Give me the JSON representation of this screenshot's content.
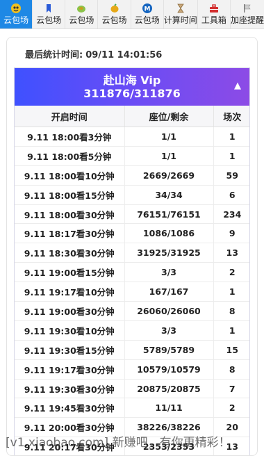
{
  "tabs": [
    {
      "label": "云包场",
      "icon": "eye-icon",
      "active": true
    },
    {
      "label": "云包场",
      "icon": "bookmark-icon",
      "active": false
    },
    {
      "label": "云包场",
      "icon": "coin-icon",
      "active": false
    },
    {
      "label": "云包场",
      "icon": "lemon-icon",
      "active": false
    },
    {
      "label": "云包场",
      "icon": "m-badge-icon",
      "active": false
    },
    {
      "label": "计算时间",
      "icon": "hourglass-icon",
      "active": false
    },
    {
      "label": "工具箱",
      "icon": "toolbox-icon",
      "active": false
    },
    {
      "label": "加座提醒",
      "icon": "flag-icon",
      "active": false
    }
  ],
  "stats": {
    "label": "最后统计时间:",
    "value": "09/11 14:01:56"
  },
  "panel": {
    "title": "赴山海 Vip",
    "count": "311876/311876",
    "collapse_glyph": "▲"
  },
  "table": {
    "headers": [
      "开启时间",
      "座位/剩余",
      "场次"
    ],
    "rows": [
      [
        "9.11 18:00看3分钟",
        "1/1",
        "1"
      ],
      [
        "9.11 18:00看5分钟",
        "1/1",
        "1"
      ],
      [
        "9.11 18:00看10分钟",
        "2669/2669",
        "59"
      ],
      [
        "9.11 18:00看15分钟",
        "34/34",
        "6"
      ],
      [
        "9.11 18:00看30分钟",
        "76151/76151",
        "234"
      ],
      [
        "9.11 18:17看30分钟",
        "1086/1086",
        "9"
      ],
      [
        "9.11 18:30看30分钟",
        "31925/31925",
        "13"
      ],
      [
        "9.11 19:00看15分钟",
        "3/3",
        "2"
      ],
      [
        "9.11 19:17看10分钟",
        "167/167",
        "1"
      ],
      [
        "9.11 19:00看30分钟",
        "26060/26060",
        "8"
      ],
      [
        "9.11 19:30看10分钟",
        "3/3",
        "1"
      ],
      [
        "9.11 19:30看15分钟",
        "5789/5789",
        "15"
      ],
      [
        "9.11 19:17看30分钟",
        "10579/10579",
        "8"
      ],
      [
        "9.11 19:30看30分钟",
        "20875/20875",
        "7"
      ],
      [
        "9.11 19:45看30分钟",
        "11/11",
        "2"
      ],
      [
        "9.11 20:00看30分钟",
        "38226/38226",
        "20"
      ],
      [
        "9.11 20:17看30分钟",
        "2353/2353",
        "13"
      ]
    ]
  },
  "watermark": "[v1.xiaobao.com] 新赚吧，有你更精彩！"
}
